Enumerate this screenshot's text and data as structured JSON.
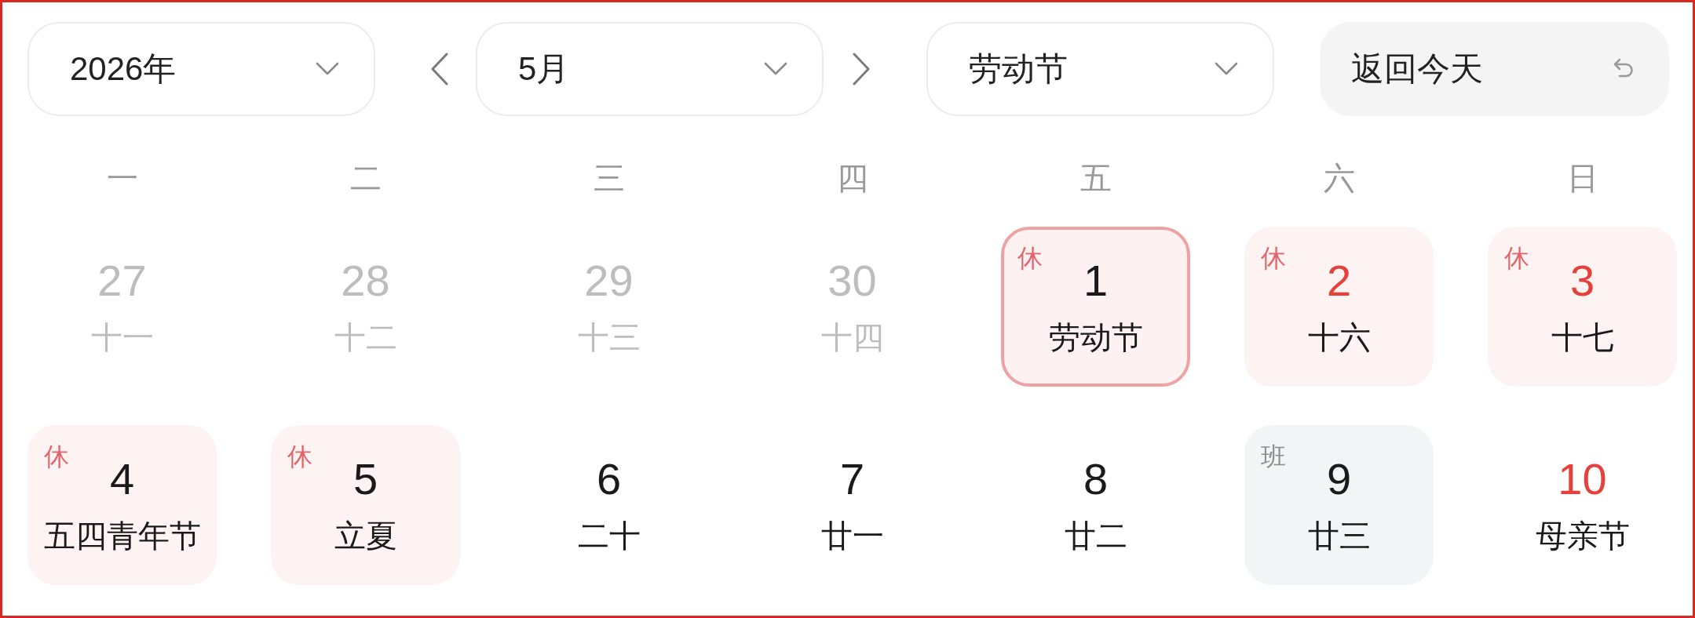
{
  "toolbar": {
    "year_select": {
      "value": "2026年"
    },
    "month_select": {
      "value": "5月"
    },
    "holiday_select": {
      "value": "劳动节"
    },
    "today_button": {
      "label": "返回今天"
    }
  },
  "weekdays": [
    "一",
    "二",
    "三",
    "四",
    "五",
    "六",
    "日"
  ],
  "days": [
    {
      "day": "27",
      "lunar": "十一",
      "kind": "outside",
      "selected": false,
      "highlighted": false
    },
    {
      "day": "28",
      "lunar": "十二",
      "kind": "outside",
      "selected": false,
      "highlighted": false
    },
    {
      "day": "29",
      "lunar": "十三",
      "kind": "outside",
      "selected": false,
      "highlighted": false
    },
    {
      "day": "30",
      "lunar": "十四",
      "kind": "outside",
      "selected": false,
      "highlighted": false
    },
    {
      "day": "1",
      "lunar": "劳动节",
      "kind": "rest",
      "badge": "休",
      "selected": true,
      "highlighted": false
    },
    {
      "day": "2",
      "lunar": "十六",
      "kind": "rest",
      "badge": "休",
      "selected": false,
      "highlighted": true
    },
    {
      "day": "3",
      "lunar": "十七",
      "kind": "rest",
      "badge": "休",
      "selected": false,
      "highlighted": true
    },
    {
      "day": "4",
      "lunar": "五四青年节",
      "kind": "rest",
      "badge": "休",
      "selected": false,
      "highlighted": false
    },
    {
      "day": "5",
      "lunar": "立夏",
      "kind": "rest",
      "badge": "休",
      "selected": false,
      "highlighted": false
    },
    {
      "day": "6",
      "lunar": "二十",
      "kind": "plain",
      "selected": false,
      "highlighted": false
    },
    {
      "day": "7",
      "lunar": "廿一",
      "kind": "plain",
      "selected": false,
      "highlighted": false
    },
    {
      "day": "8",
      "lunar": "廿二",
      "kind": "plain",
      "selected": false,
      "highlighted": false
    },
    {
      "day": "9",
      "lunar": "廿三",
      "kind": "work",
      "badge": "班",
      "selected": false,
      "highlighted": false
    },
    {
      "day": "10",
      "lunar": "母亲节",
      "kind": "plain",
      "selected": false,
      "highlighted": true
    }
  ]
}
